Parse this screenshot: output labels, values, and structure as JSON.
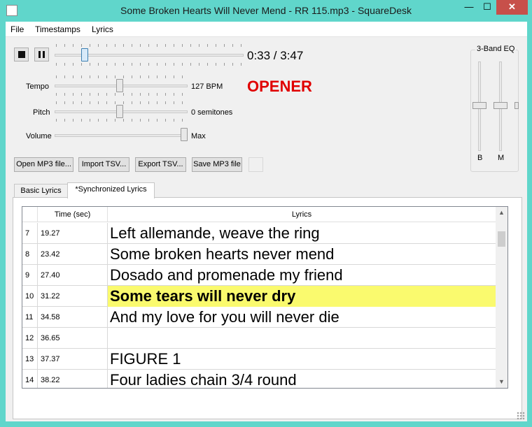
{
  "window": {
    "title": "Some Broken Hearts Will Never Mend - RR 115.mp3 - SquareDesk",
    "controls": {
      "minimize": "—",
      "maximize": "☐",
      "close": "✕"
    }
  },
  "menu": {
    "items": [
      "File",
      "Timestamps",
      "Lyrics"
    ]
  },
  "player": {
    "time_display": "0:33 / 3:47",
    "position_fraction": 0.145
  },
  "sliders": {
    "tempo": {
      "label": "Tempo",
      "value_text": "127 BPM",
      "fraction": 0.49
    },
    "pitch": {
      "label": "Pitch",
      "value_text": "0 semitones",
      "fraction": 0.49
    },
    "volume": {
      "label": "Volume",
      "value_text": "Max",
      "fraction": 1.0
    }
  },
  "section_label": "OPENER",
  "section_label_color": "#e00000",
  "buttons": {
    "open_mp3": "Open MP3 file...",
    "import_tsv": "Import TSV...",
    "export_tsv": "Export TSV...",
    "save_mp3": "Save MP3 file"
  },
  "eq": {
    "title": "3-Band EQ",
    "bands": [
      {
        "label": "B"
      },
      {
        "label": "M"
      }
    ]
  },
  "tabs": [
    {
      "label": "Basic Lyrics",
      "active": false
    },
    {
      "label": "*Synchronized Lyrics",
      "active": true
    }
  ],
  "table": {
    "headers": {
      "num": "",
      "time": "Time (sec)",
      "lyrics": "Lyrics"
    },
    "rows": [
      {
        "num": "7",
        "time": "19.27",
        "lyric": "Left allemande, weave the ring",
        "highlight": false
      },
      {
        "num": "8",
        "time": "23.42",
        "lyric": "Some broken hearts never mend",
        "highlight": false
      },
      {
        "num": "9",
        "time": "27.40",
        "lyric": "Dosado and promenade my friend",
        "highlight": false
      },
      {
        "num": "10",
        "time": "31.22",
        "lyric": "Some tears will never dry",
        "highlight": true
      },
      {
        "num": "11",
        "time": "34.58",
        "lyric": "And my love for you will never die",
        "highlight": false
      },
      {
        "num": "12",
        "time": "36.65",
        "lyric": "",
        "highlight": false
      },
      {
        "num": "13",
        "time": "37.37",
        "lyric": "FIGURE 1",
        "highlight": false
      },
      {
        "num": "14",
        "time": "38.22",
        "lyric": "Four ladies chain 3/4 round",
        "highlight": false
      }
    ],
    "highlight_color": "#fafa6e"
  }
}
